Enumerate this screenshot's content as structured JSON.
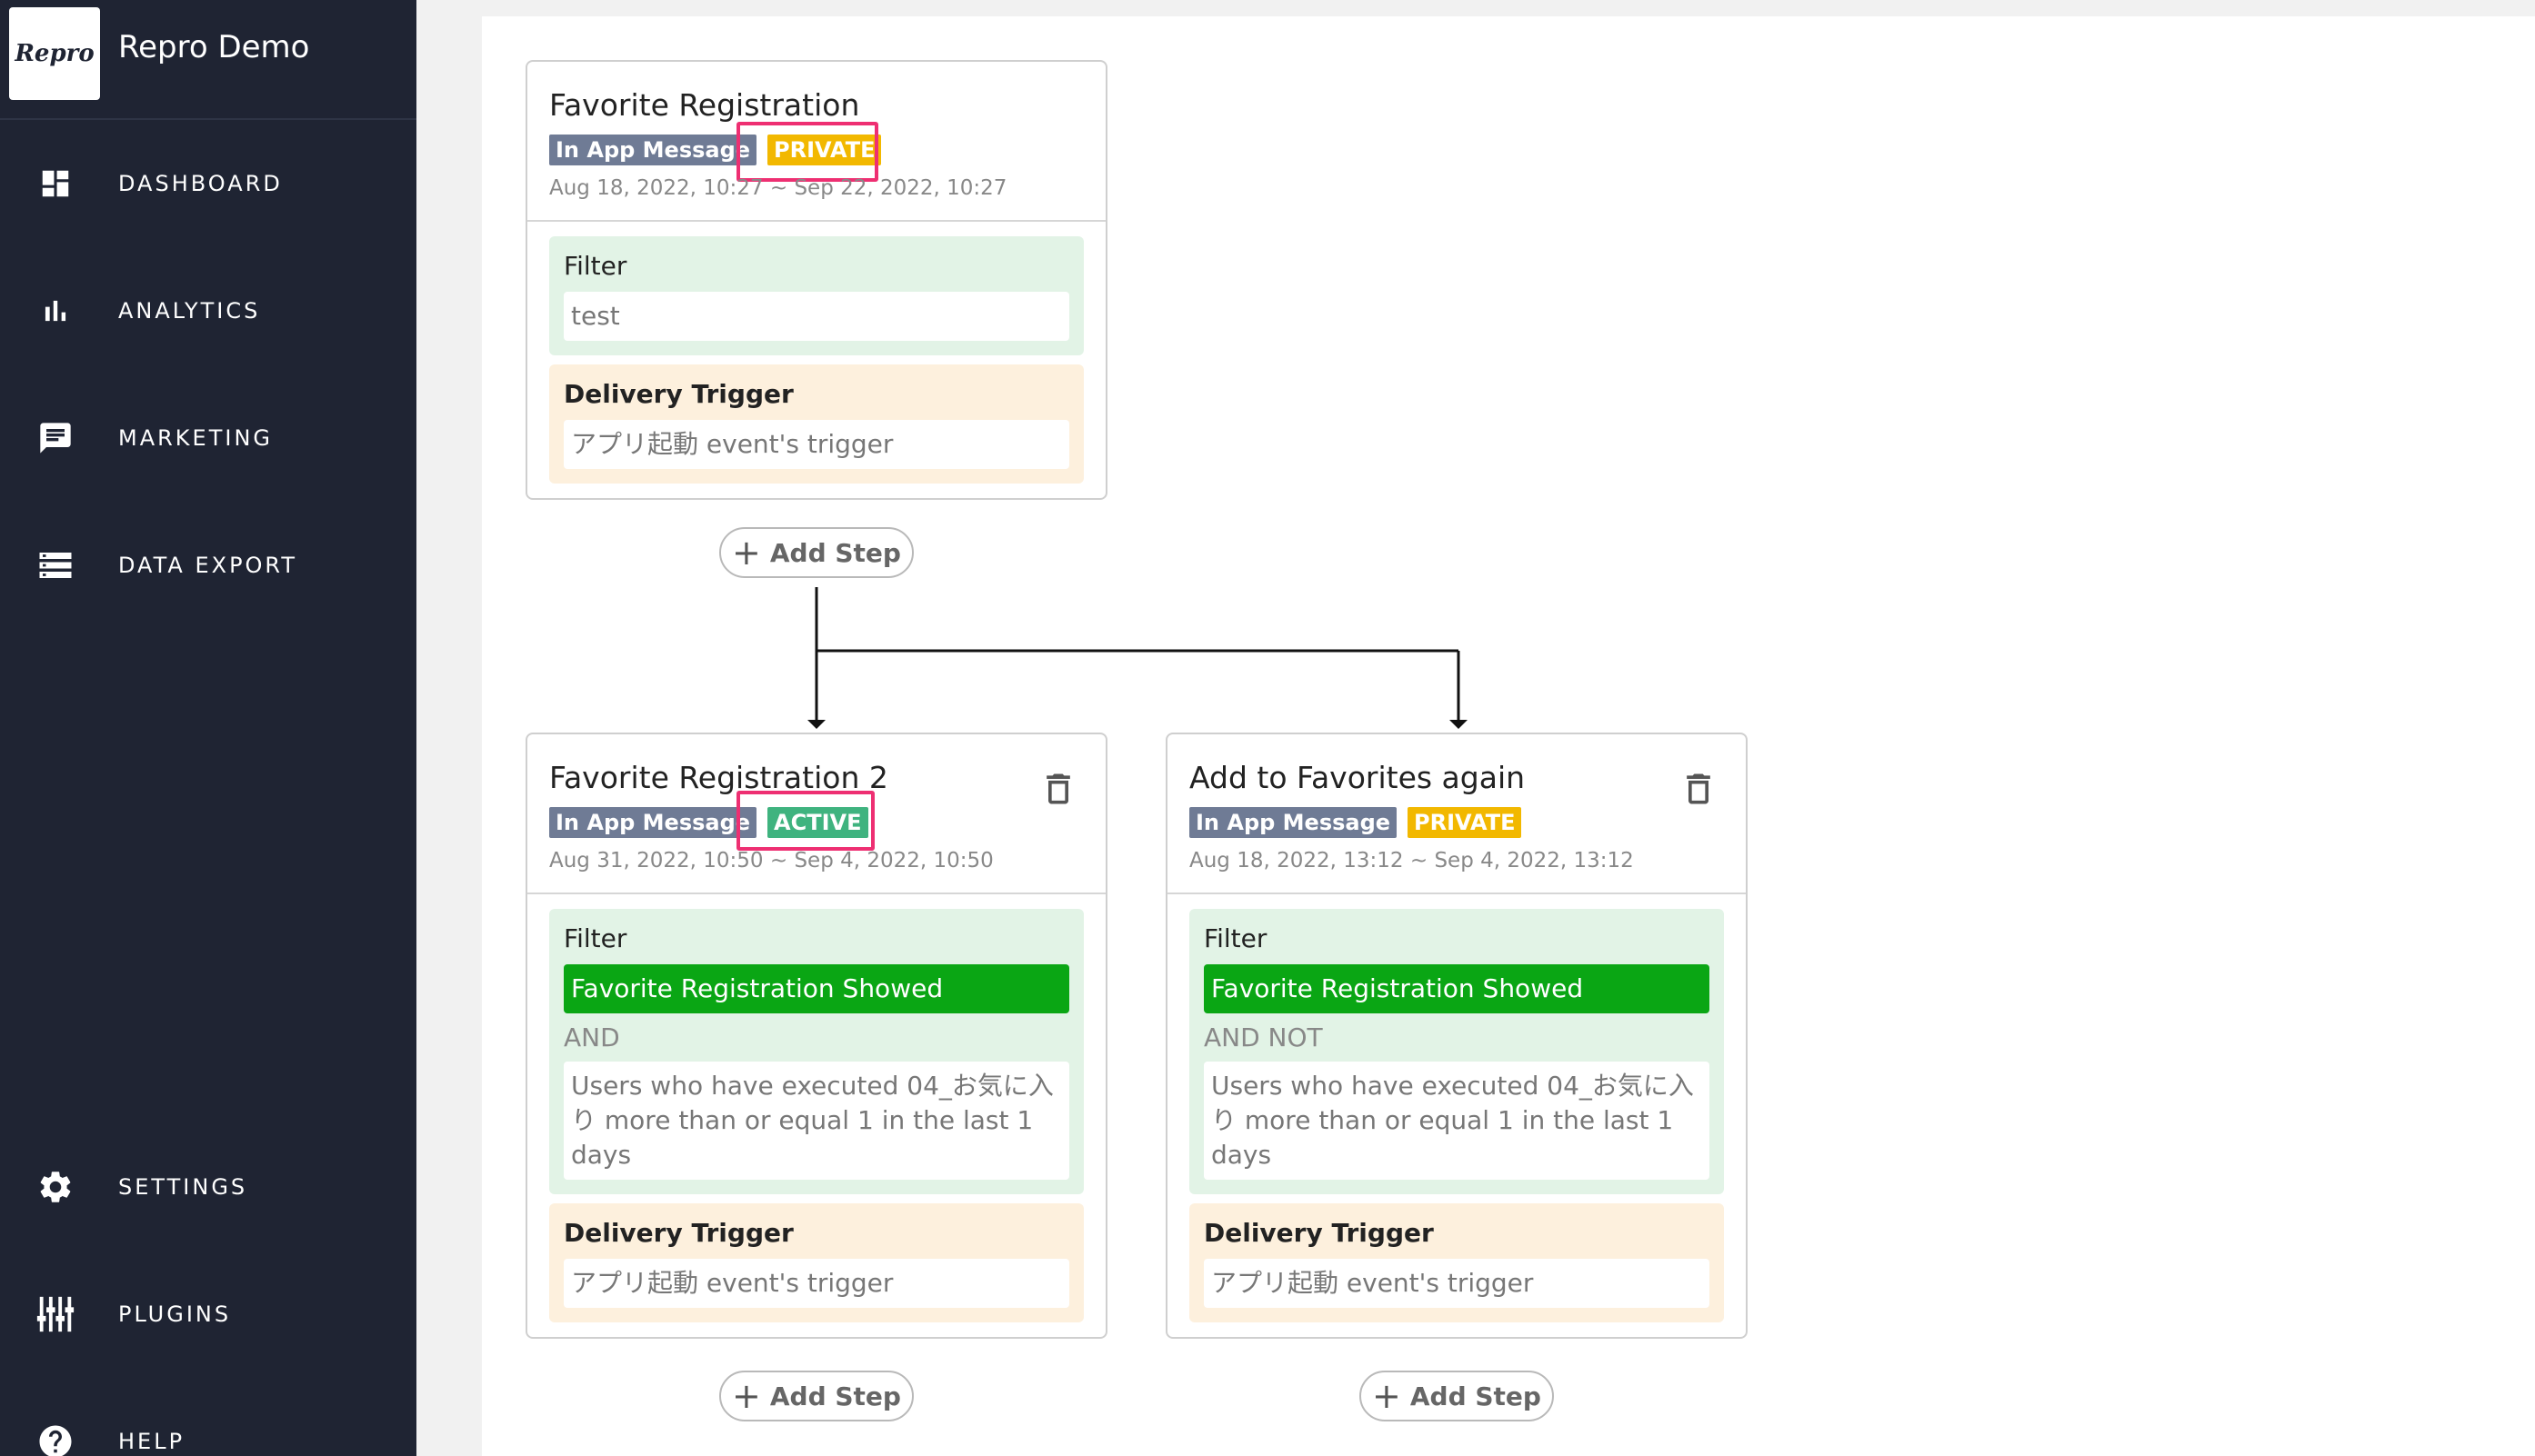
{
  "app": {
    "logo": "Repro",
    "name": "Repro Demo"
  },
  "nav": {
    "dashboard": "DASHBOARD",
    "analytics": "ANALYTICS",
    "marketing": "MARKETING",
    "data_export": "DATA EXPORT",
    "settings": "SETTINGS",
    "plugins": "PLUGINS",
    "help": "HELP"
  },
  "icons": {
    "dashboard": "dashboard-icon",
    "analytics": "bar-chart-icon",
    "marketing": "chat-icon",
    "data_export": "list-icon",
    "settings": "gear-icon",
    "plugins": "sliders-icon",
    "help": "help-icon",
    "delete": "trash-icon",
    "add": "plus-icon"
  },
  "colors": {
    "sidebar": "#1f2433",
    "private": "#f2b800",
    "active": "#3fb37f",
    "message_type": "#6f7b95",
    "highlight": "#ee2f72",
    "filter_bg": "#e2f3e6",
    "trigger_bg": "#fdf0dd",
    "event_chip": "#0aa614"
  },
  "add_step_label": "Add Step",
  "cards": [
    {
      "title": "Favorite Registration",
      "type": "In App Message",
      "status": "PRIVATE",
      "dates": "Aug 18, 2022, 10:27 ~ Sep 22, 2022, 10:27",
      "filter": {
        "label": "Filter",
        "value": "test"
      },
      "trigger": {
        "label": "Delivery Trigger",
        "value": "アプリ起動 event's trigger"
      }
    },
    {
      "title": "Favorite Registration 2",
      "type": "In App Message",
      "status": "ACTIVE",
      "dates": "Aug 31, 2022, 10:50 ~ Sep 4, 2022, 10:50",
      "filter": {
        "label": "Filter",
        "event": "Favorite Registration Showed",
        "logic": "AND",
        "condition": "Users who have executed 04_お気に入り more than or equal 1 in the last 1 days"
      },
      "trigger": {
        "label": "Delivery Trigger",
        "value": "アプリ起動 event's trigger"
      }
    },
    {
      "title": "Add to Favorites again",
      "type": "In App Message",
      "status": "PRIVATE",
      "dates": "Aug 18, 2022, 13:12 ~ Sep 4, 2022, 13:12",
      "filter": {
        "label": "Filter",
        "event": "Favorite Registration Showed",
        "logic": "AND NOT",
        "condition": "Users who have executed 04_お気に入り more than or equal 1 in the last 1 days"
      },
      "trigger": {
        "label": "Delivery Trigger",
        "value": "アプリ起動 event's trigger"
      }
    }
  ]
}
